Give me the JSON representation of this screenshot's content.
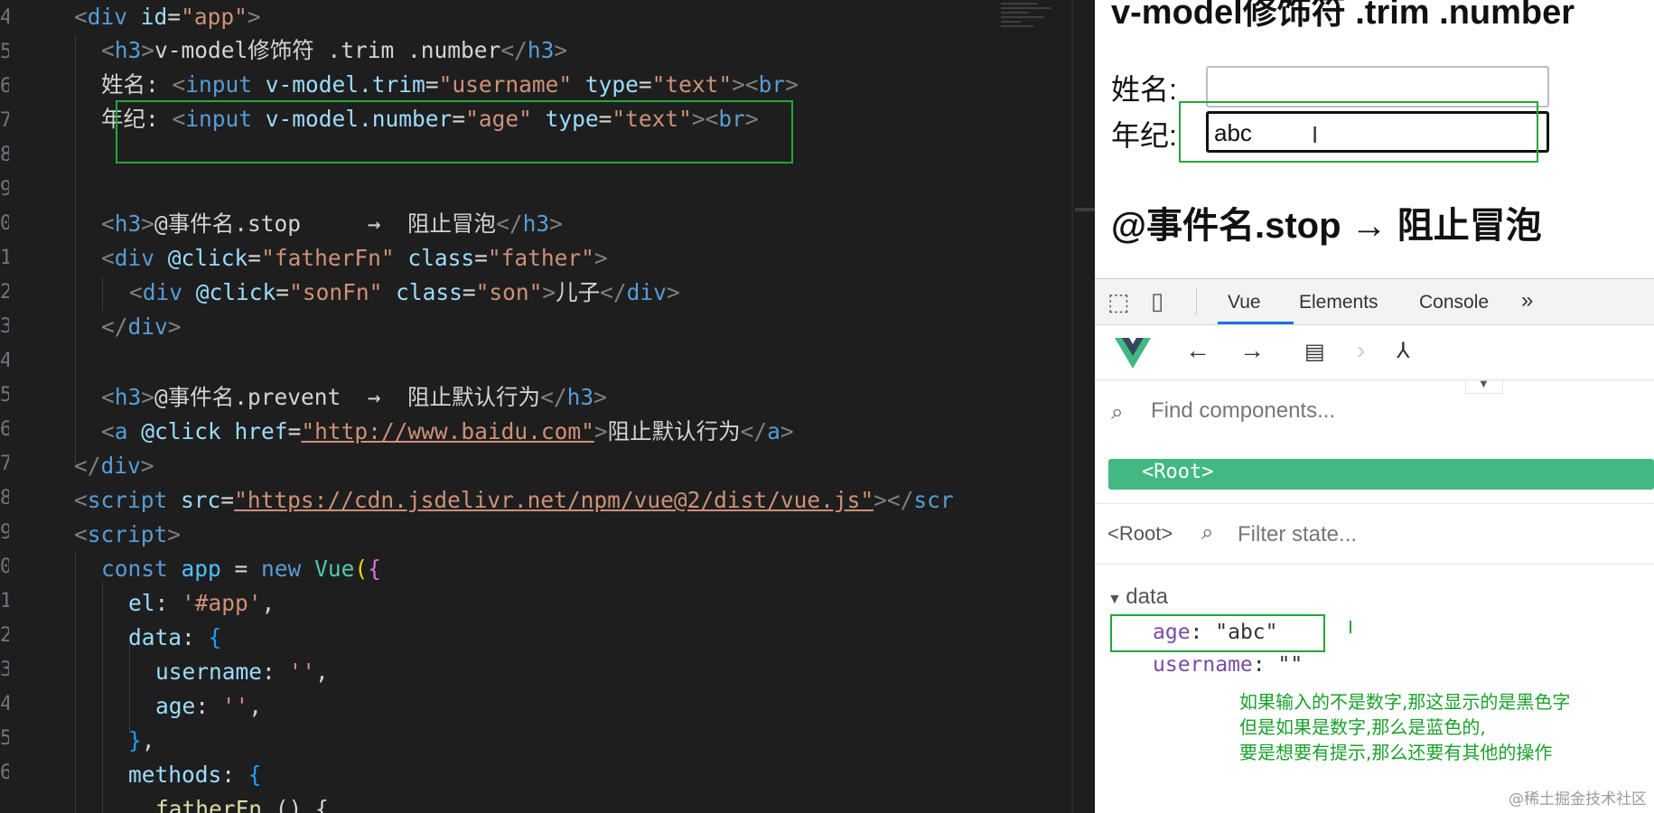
{
  "editor": {
    "line_numbers": [
      "4",
      "5",
      "6",
      "7",
      "8",
      "9",
      "0",
      "1",
      "2",
      "3",
      "4",
      "5",
      "6",
      "7",
      "8",
      "9",
      "0",
      "1",
      "2",
      "3",
      "4",
      "5",
      "6"
    ],
    "lines": {
      "l1": {
        "a": "<",
        "b": "div",
        "c": " id",
        "d": "=",
        "e": "\"app\"",
        "f": ">"
      },
      "l2": {
        "a": "<",
        "b": "h3",
        "c": ">",
        "d": "v-model修饰符 .trim .number",
        "e": "</",
        "f": "h3",
        "g": ">"
      },
      "l3": {
        "a": "姓名: ",
        "b": "<",
        "c": "input",
        "d": " v-model.trim",
        "e": "=",
        "f": "\"username\"",
        "g": " type",
        "h": "=",
        "i": "\"text\"",
        "j": "><",
        "k": "br",
        "l": ">"
      },
      "l4": {
        "a": "年纪: ",
        "b": "<",
        "c": "input",
        "d": " v-model.number",
        "e": "=",
        "f": "\"age\"",
        "g": " type",
        "h": "=",
        "i": "\"text\"",
        "j": "><",
        "k": "br",
        "l": ">"
      },
      "l7": {
        "a": "<",
        "b": "h3",
        "c": ">",
        "d": "@事件名.stop     →  阻止冒泡",
        "e": "</",
        "f": "h3",
        "g": ">"
      },
      "l8": {
        "a": "<",
        "b": "div",
        "c": " @click",
        "d": "=",
        "e": "\"fatherFn\"",
        "f": " class",
        "g": "=",
        "h": "\"father\"",
        "i": ">"
      },
      "l9": {
        "a": "<",
        "b": "div",
        "c": " @click",
        "d": "=",
        "e": "\"sonFn\"",
        "f": " class",
        "g": "=",
        "h": "\"son\"",
        "i": ">",
        "j": "儿子",
        "k": "</",
        "l": "div",
        "m": ">"
      },
      "l10": {
        "a": "</",
        "b": "div",
        "c": ">"
      },
      "l12": {
        "a": "<",
        "b": "h3",
        "c": ">",
        "d": "@事件名.prevent  →  阻止默认行为",
        "e": "</",
        "f": "h3",
        "g": ">"
      },
      "l13": {
        "a": "<",
        "b": "a",
        "c": " @click",
        "d": " href",
        "e": "=",
        "f": "\"http://www.baidu.com\"",
        "g": ">",
        "h": "阻止默认行为",
        "i": "</",
        "j": "a",
        "k": ">"
      },
      "l14": {
        "a": "</",
        "b": "div",
        "c": ">"
      },
      "l15": {
        "a": "<",
        "b": "script",
        "c": " src",
        "d": "=",
        "e": "\"https://cdn.jsdelivr.net/npm/vue@2/dist/vue.js\"",
        "f": "></",
        "g": "scr"
      },
      "l16": {
        "a": "<",
        "b": "script",
        "c": ">"
      },
      "l17": {
        "a": "const",
        "b": " app",
        "c": " = ",
        "d": "new",
        "e": " Vue",
        "f": "(",
        "g": "{"
      },
      "l18": {
        "a": "el",
        "b": ": ",
        "c": "'#app'",
        "d": ","
      },
      "l19": {
        "a": "data",
        "b": ": ",
        "c": "{"
      },
      "l20": {
        "a": "username",
        "b": ": ",
        "c": "''",
        "d": ","
      },
      "l21": {
        "a": "age",
        "b": ": ",
        "c": "''",
        "d": ","
      },
      "l22": {
        "a": "}",
        "b": ","
      },
      "l23": {
        "a": "methods",
        "b": ": ",
        "c": "{"
      },
      "l24": {
        "a": "fatherFn",
        "b": " () {"
      }
    }
  },
  "browser": {
    "h3_top": "v-model修饰符 .trim .number",
    "name_label": "姓名:",
    "age_label": "年纪:",
    "name_value": "",
    "age_value": "abc",
    "h3_stop": "@事件名.stop → 阻止冒泡"
  },
  "devtools": {
    "tabs": [
      "Vue",
      "Elements",
      "Console",
      "»"
    ],
    "find_placeholder": "Find components...",
    "root_component": "<Root>",
    "state_root": "<Root>",
    "filter_placeholder": "Filter state...",
    "data_section": "data",
    "props": [
      {
        "key": "age",
        "value": "\"abc\""
      },
      {
        "key": "username",
        "value": "\"\""
      }
    ]
  },
  "annotations": [
    "如果输入的不是数字,那这显示的是黑色字",
    "但是如果是数字,那么是蓝色的,",
    "要是想要有提示,那么还要有其他的操作"
  ],
  "watermark": "@稀土掘金技术社区",
  "colors": {
    "highlight": "#22a83a",
    "vue_green": "#42b883",
    "note_green": "#1aa12b"
  }
}
